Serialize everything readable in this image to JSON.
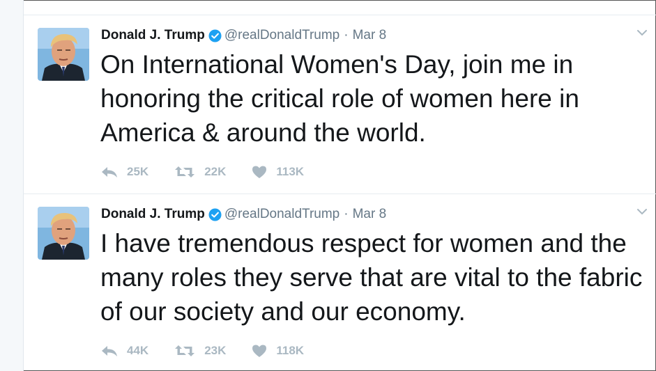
{
  "tweets": [
    {
      "name": "Donald J. Trump",
      "handle": "@realDonaldTrump",
      "separator": "·",
      "date": "Mar 8",
      "text": "On International Women's Day, join me in honoring the critical role of women here in America & around the world.",
      "replies": "25K",
      "retweets": "22K",
      "likes": "113K"
    },
    {
      "name": "Donald J. Trump",
      "handle": "@realDonaldTrump",
      "separator": "·",
      "date": "Mar 8",
      "text": "I have tremendous respect for women and the many roles they serve that are vital to the fabric of our society and our economy.",
      "replies": "44K",
      "retweets": "23K",
      "likes": "118K"
    }
  ],
  "colors": {
    "verified": "#1da1f2",
    "action_icons": "#aab8c2",
    "secondary_text": "#657786"
  },
  "icons": [
    "verified-badge-icon",
    "chevron-down-icon",
    "reply-icon",
    "retweet-icon",
    "like-heart-icon"
  ]
}
